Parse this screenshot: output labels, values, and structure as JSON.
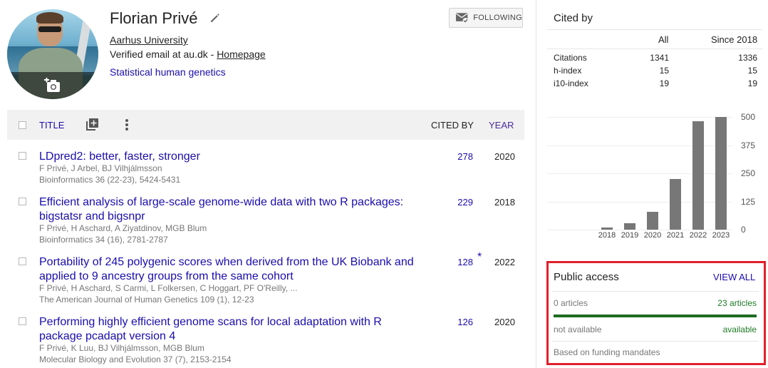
{
  "profile": {
    "name": "Florian Privé",
    "affiliation": "Aarhus University",
    "email_text": "Verified email at au.dk - ",
    "homepage_label": "Homepage",
    "interests": [
      "Statistical human genetics"
    ],
    "follow_label": "FOLLOWING"
  },
  "table": {
    "title_header": "TITLE",
    "cited_header": "CITED BY",
    "year_header": "YEAR"
  },
  "articles": [
    {
      "title": "LDpred2: better, faster, stronger",
      "authors": "F Privé, J Arbel, BJ Vilhjálmsson",
      "venue": "Bioinformatics 36 (22-23), 5424-5431",
      "cited": "278",
      "star": "",
      "year": "2020"
    },
    {
      "title": "Efficient analysis of large-scale genome-wide data with two R packages: bigstatsr and bigsnpr",
      "authors": "F Privé, H Aschard, A Ziyatdinov, MGB Blum",
      "venue": "Bioinformatics 34 (16), 2781-2787",
      "cited": "229",
      "star": "",
      "year": "2018"
    },
    {
      "title": "Portability of 245 polygenic scores when derived from the UK Biobank and applied to 9 ancestry groups from the same cohort",
      "authors": "F Privé, H Aschard, S Carmi, L Folkersen, C Hoggart, PF O'Reilly, ...",
      "venue": "The American Journal of Human Genetics 109 (1), 12-23",
      "cited": "128",
      "star": "*",
      "year": "2022"
    },
    {
      "title": "Performing highly efficient genome scans for local adaptation with R package pcadapt version 4",
      "authors": "F Privé, K Luu, BJ Vilhjálmsson, MGB Blum",
      "venue": "Molecular Biology and Evolution 37 (7), 2153-2154",
      "cited": "126",
      "star": "",
      "year": "2020"
    }
  ],
  "cited_by": {
    "title": "Cited by",
    "col_all": "All",
    "col_since": "Since 2018",
    "rows": [
      {
        "label": "Citations",
        "all": "1341",
        "since": "1336"
      },
      {
        "label": "h-index",
        "all": "15",
        "since": "15"
      },
      {
        "label": "i10-index",
        "all": "19",
        "since": "19"
      }
    ]
  },
  "chart_data": {
    "type": "bar",
    "categories": [
      "2018",
      "2019",
      "2020",
      "2021",
      "2022",
      "2023"
    ],
    "values": [
      8,
      30,
      80,
      225,
      480,
      500
    ],
    "yticks": [
      "500",
      "375",
      "250",
      "125",
      "0"
    ],
    "ylim": [
      0,
      500
    ]
  },
  "public_access": {
    "title": "Public access",
    "view_all": "VIEW ALL",
    "not_available_count": "0 articles",
    "available_count": "23 articles",
    "not_available_label": "not available",
    "available_label": "available",
    "footer": "Based on funding mandates",
    "available_fraction": 1.0
  }
}
